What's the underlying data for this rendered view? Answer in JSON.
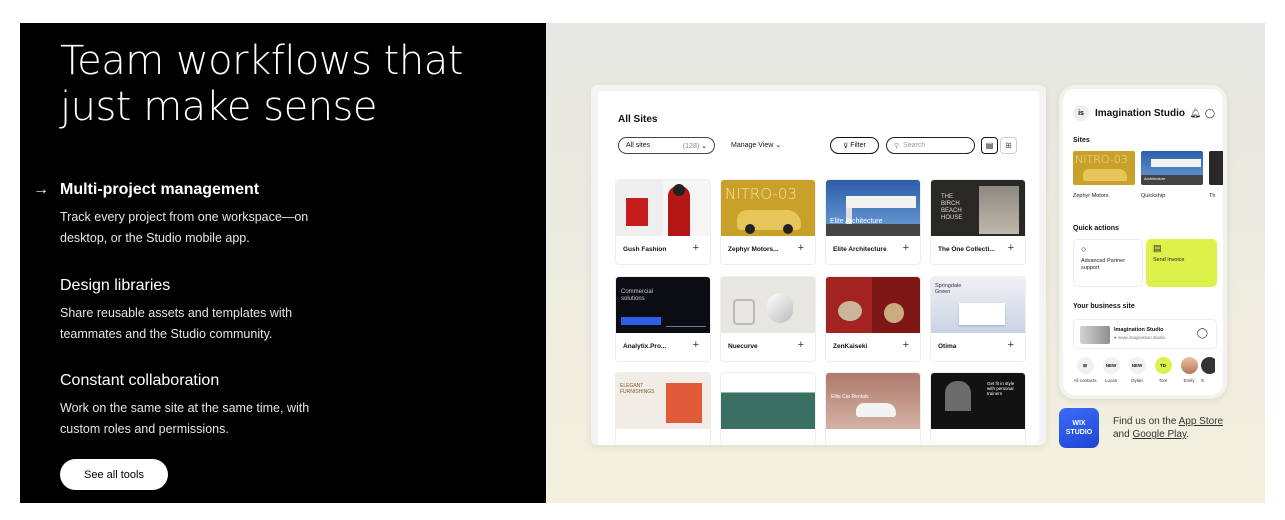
{
  "left": {
    "headline": "Team workflows that just make sense",
    "features": [
      {
        "title": "Multi-project management",
        "desc": "Track every project from one workspace—on desktop, or the Studio mobile app.",
        "active": true
      },
      {
        "title": "Design libraries",
        "desc": "Share reusable assets and templates with teammates and the Studio community.",
        "active": false
      },
      {
        "title": "Constant collaboration",
        "desc": "Work on the same site at the same time, with custom roles and permissions.",
        "active": false
      }
    ],
    "cta": "See all tools",
    "arrow": "→"
  },
  "dashboard": {
    "title": "All Sites",
    "all_sites_label": "All sites",
    "all_sites_count": "(128)",
    "manage_view": "Manage View",
    "filter": "Filter",
    "search_placeholder": "Search",
    "cards": [
      {
        "label": "Gush Fashion",
        "thumb_text": ""
      },
      {
        "label": "Zephyr Motors...",
        "thumb_text": "NITRO-03"
      },
      {
        "label": "Elite Architecture",
        "thumb_text": "Elite Architecture"
      },
      {
        "label": "The One Collecti...",
        "thumb_text": "THE BIRCH BEACH HOUSE"
      },
      {
        "label": "Analytix.Pro...",
        "thumb_text": "Commercial solutions"
      },
      {
        "label": "Nuecurve",
        "thumb_text": ""
      },
      {
        "label": "ZenKaiseki",
        "thumb_text": ""
      },
      {
        "label": "Ótima",
        "thumb_text": "Springdale Green"
      },
      {
        "label": "",
        "thumb_text": "ELEGANT FURNISHINGS"
      },
      {
        "label": "",
        "thumb_text": ""
      },
      {
        "label": "",
        "thumb_text": "Elite Car Rentals"
      },
      {
        "label": "",
        "thumb_text": "Get fit in style with personal trainers"
      }
    ]
  },
  "phone": {
    "title": "Imagination Studio",
    "logo": "is",
    "sites_label": "Sites",
    "sites": [
      {
        "name": "Zephyr Motors",
        "thumb_text": "NITRO-03"
      },
      {
        "name": "Quickship",
        "thumb_text": "Architecture"
      },
      {
        "name": "Th",
        "thumb_text": ""
      }
    ],
    "quick_actions_label": "Quick actions",
    "quick_actions": [
      "Advanced Partner support",
      "Send invoice"
    ],
    "business_label": "Your business site",
    "business_name": "Imagination Studio",
    "business_url": "● www.imagination.studio",
    "contacts": [
      {
        "badge": "⊞",
        "name": "All contacts"
      },
      {
        "badge": "NEW",
        "name": "Lucas"
      },
      {
        "badge": "NEW",
        "name": "Dylan"
      },
      {
        "badge": "TD",
        "name": "Tom"
      },
      {
        "badge": "",
        "name": "Emily"
      },
      {
        "badge": "",
        "name": "S"
      }
    ]
  },
  "appstore": {
    "logo_line1": "WIX",
    "logo_line2": "STUDIO",
    "text_prefix": "Find us on the ",
    "app_store": "App Store",
    "and": " and ",
    "google_play": "Google Play",
    "suffix": "."
  },
  "colors": {
    "accent_lime": "#dcf24a",
    "wix_blue": "#2f5ae6"
  }
}
